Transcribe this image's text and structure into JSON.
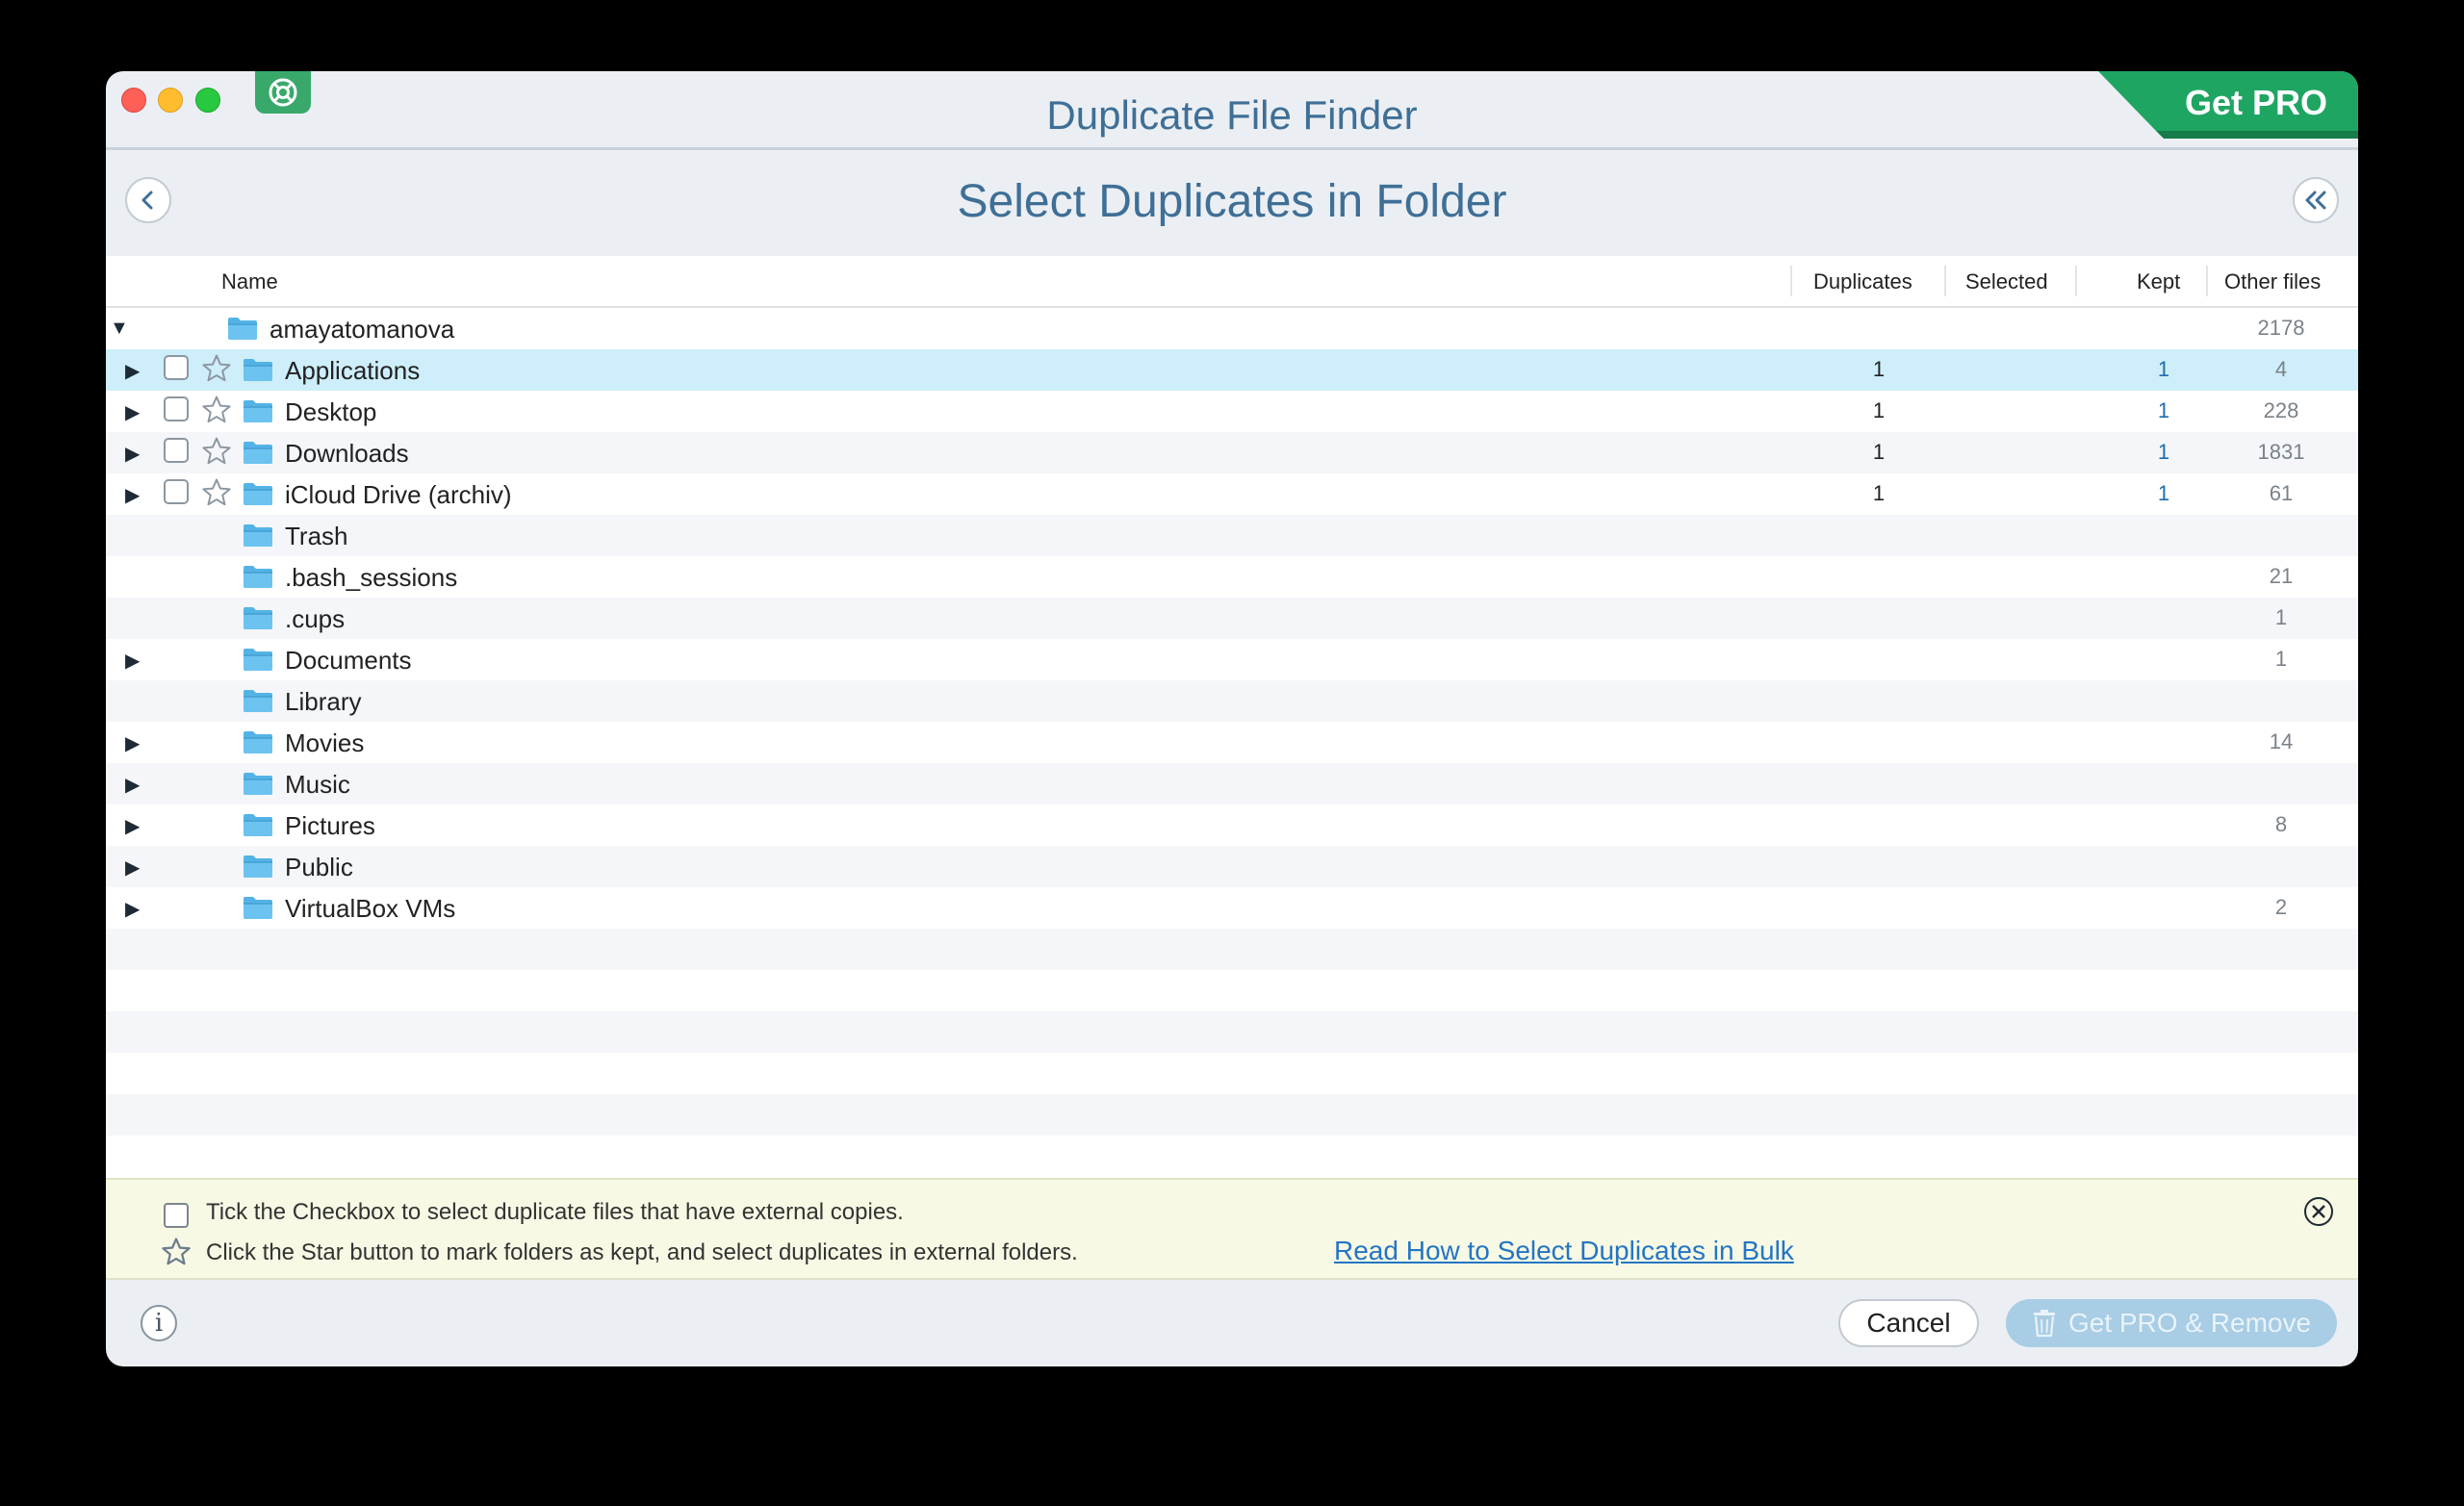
{
  "window": {
    "app_title": "Duplicate File Finder",
    "get_pro_label": "Get PRO",
    "page_title": "Select Duplicates in Folder"
  },
  "table": {
    "columns": {
      "name": "Name",
      "duplicates": "Duplicates",
      "selected": "Selected",
      "kept": "Kept",
      "other": "Other files"
    },
    "rows": [
      {
        "name": "amayatomanova",
        "level": 0,
        "expanded": true,
        "selectable": false,
        "duplicates": "",
        "kept": "",
        "other": "2178",
        "folder_icon": "home-folder-icon"
      },
      {
        "name": "Applications",
        "level": 1,
        "expandable": true,
        "selectable": true,
        "highlighted": true,
        "duplicates": "1",
        "kept": "1",
        "other": "4",
        "folder_icon": "applications-folder-icon"
      },
      {
        "name": "Desktop",
        "level": 1,
        "expandable": true,
        "selectable": true,
        "duplicates": "1",
        "kept": "1",
        "other": "228",
        "folder_icon": "desktop-folder-icon"
      },
      {
        "name": "Downloads",
        "level": 1,
        "expandable": true,
        "selectable": true,
        "duplicates": "1",
        "kept": "1",
        "other": "1831",
        "folder_icon": "downloads-folder-icon"
      },
      {
        "name": "iCloud Drive (archiv)",
        "level": 1,
        "expandable": true,
        "selectable": true,
        "duplicates": "1",
        "kept": "1",
        "other": "61",
        "folder_icon": "folder-icon"
      },
      {
        "name": "Trash",
        "level": 1,
        "expandable": false,
        "selectable": false,
        "duplicates": "",
        "kept": "",
        "other": "",
        "folder_icon": "folder-icon"
      },
      {
        "name": ".bash_sessions",
        "level": 1,
        "expandable": false,
        "selectable": false,
        "duplicates": "",
        "kept": "",
        "other": "21",
        "folder_icon": "folder-icon"
      },
      {
        "name": ".cups",
        "level": 1,
        "expandable": false,
        "selectable": false,
        "duplicates": "",
        "kept": "",
        "other": "1",
        "folder_icon": "folder-icon"
      },
      {
        "name": "Documents",
        "level": 1,
        "expandable": true,
        "selectable": false,
        "duplicates": "",
        "kept": "",
        "other": "1",
        "folder_icon": "documents-folder-icon"
      },
      {
        "name": "Library",
        "level": 1,
        "expandable": false,
        "selectable": false,
        "duplicates": "",
        "kept": "",
        "other": "",
        "folder_icon": "library-folder-icon"
      },
      {
        "name": "Movies",
        "level": 1,
        "expandable": true,
        "selectable": false,
        "duplicates": "",
        "kept": "",
        "other": "14",
        "folder_icon": "movies-folder-icon"
      },
      {
        "name": "Music",
        "level": 1,
        "expandable": true,
        "selectable": false,
        "duplicates": "",
        "kept": "",
        "other": "",
        "folder_icon": "music-folder-icon"
      },
      {
        "name": "Pictures",
        "level": 1,
        "expandable": true,
        "selectable": false,
        "duplicates": "",
        "kept": "",
        "other": "8",
        "folder_icon": "pictures-folder-icon"
      },
      {
        "name": "Public",
        "level": 1,
        "expandable": true,
        "selectable": false,
        "duplicates": "",
        "kept": "",
        "other": "",
        "folder_icon": "public-folder-icon"
      },
      {
        "name": "VirtualBox VMs",
        "level": 1,
        "expandable": true,
        "selectable": false,
        "duplicates": "",
        "kept": "",
        "other": "2",
        "folder_icon": "folder-icon"
      }
    ]
  },
  "hint": {
    "checkbox_text": "Tick the Checkbox to select duplicate files that have external copies.",
    "star_text": "Click the Star button to mark folders as kept, and select duplicates in external folders.",
    "link_text": "Read How to Select Duplicates in Bulk"
  },
  "footer": {
    "info_label": "i",
    "cancel_label": "Cancel",
    "remove_label": "Get PRO & Remove"
  },
  "colors": {
    "title_blue": "#3f6f96",
    "pro_green": "#1fa562",
    "selected_row": "#cdeefa",
    "folder_blue": "#54b3e6",
    "link_blue": "#2375c5",
    "kept_blue": "#1f6dae"
  }
}
